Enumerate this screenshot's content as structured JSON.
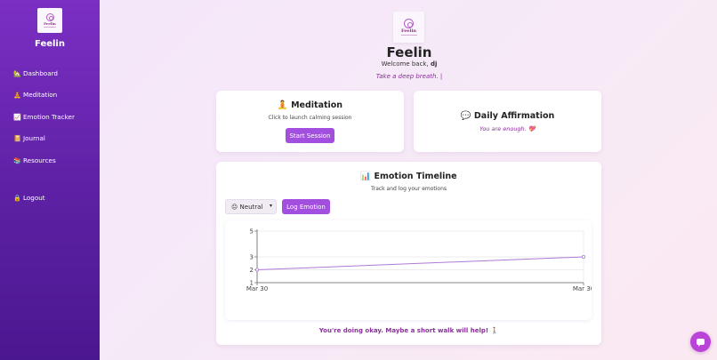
{
  "sidebar": {
    "logo_text": "Feelin",
    "brand": "Feelin",
    "items": [
      {
        "icon": "🏡",
        "label": "Dashboard"
      },
      {
        "icon": "🧘",
        "label": "Meditation"
      },
      {
        "icon": "📈",
        "label": "Emotion Tracker"
      },
      {
        "icon": "📔",
        "label": "Journal"
      },
      {
        "icon": "📚",
        "label": "Resources"
      },
      {
        "icon": "🔒",
        "label": "Logout"
      }
    ]
  },
  "header": {
    "logo_text": "Feelin",
    "title": "Feelin",
    "welcome_prefix": "Welcome back,",
    "username": "dj",
    "tagline": "Take a deep breath. |"
  },
  "meditation": {
    "icon": "🧘",
    "title": "Meditation",
    "subtitle": "Click to launch calming session",
    "button": "Start Session"
  },
  "affirmation": {
    "icon": "💬",
    "title": "Daily Affirmation",
    "text": "You are enough. 💖"
  },
  "timeline": {
    "icon": "📊",
    "title": "Emotion Timeline",
    "subtitle": "Track and log your emotions",
    "select_value": "😐 Neutral",
    "button": "Log Emotion",
    "message": "You're doing okay. Maybe a short walk will help! 🚶"
  },
  "colors": {
    "accent": "#a24fe0",
    "line": "#b07ad8",
    "sidebar_top": "#7b2fc3",
    "sidebar_bottom": "#4b1790"
  },
  "chart_data": {
    "type": "line",
    "x": [
      "Mar 30",
      "Mar 30"
    ],
    "series": [
      {
        "values": [
          2,
          3
        ]
      }
    ],
    "yticks": [
      1,
      2,
      3,
      5
    ],
    "ylim": [
      1,
      5
    ],
    "grid": true,
    "legend": "none"
  }
}
